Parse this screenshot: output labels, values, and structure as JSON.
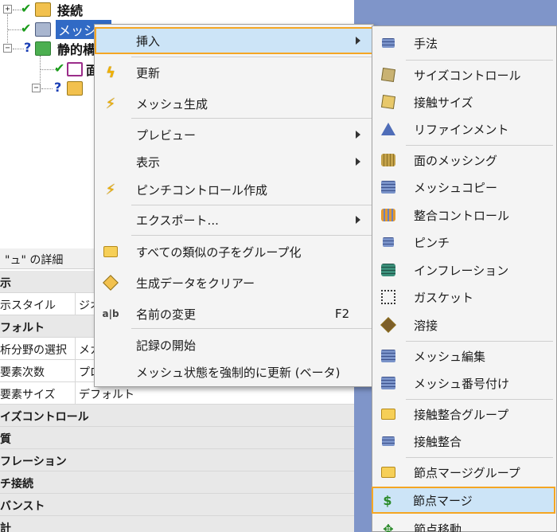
{
  "tree": {
    "row1_label": "接続",
    "row2_label": "メッシュ",
    "row3_label": "静的構",
    "row4_label": "面"
  },
  "details": {
    "header": "\"ュ\" の詳細",
    "rows": [
      {
        "c1": "示",
        "c2": "",
        "section": true
      },
      {
        "c1": "示スタイル",
        "c2": "ジオ",
        "section": false
      },
      {
        "c1": "フォルト",
        "c2": "",
        "section": true
      },
      {
        "c1": "析分野の選択",
        "c2": "メカ",
        "section": false
      },
      {
        "c1": "要素次数",
        "c2": "プロ",
        "section": false
      },
      {
        "c1": "要素サイズ",
        "c2": "デフォルト",
        "section": false
      },
      {
        "c1": "イズコントロール",
        "c2": "",
        "section": true
      },
      {
        "c1": "質",
        "c2": "",
        "section": true
      },
      {
        "c1": "フレーション",
        "c2": "",
        "section": true
      },
      {
        "c1": "チ接続",
        "c2": "",
        "section": true
      },
      {
        "c1": "バンスト",
        "c2": "",
        "section": true
      },
      {
        "c1": "計",
        "c2": "",
        "section": true
      }
    ]
  },
  "context_menu": {
    "insert": "挿入",
    "update": "更新",
    "generate_mesh": "メッシュ生成",
    "preview": "プレビュー",
    "show": "表示",
    "create_pinch": "ピンチコントロール作成",
    "export": "エクスポート...",
    "group_similar": "すべての類似の子をグループ化",
    "clear_generated": "生成データをクリアー",
    "rename": "名前の変更",
    "rename_shortcut": "F2",
    "start_recording": "記録の開始",
    "force_update": "メッシュ状態を強制的に更新 (ベータ)"
  },
  "submenu": {
    "method": "手法",
    "sizing": "サイズコントロール",
    "contact_sizing": "接触サイズ",
    "refinement": "リファインメント",
    "face_meshing": "面のメッシング",
    "mesh_copy": "メッシュコピー",
    "match_control": "整合コントロール",
    "pinch": "ピンチ",
    "inflation": "インフレーション",
    "gasket": "ガスケット",
    "weld": "溶接",
    "mesh_edit": "メッシュ編集",
    "mesh_numbering": "メッシュ番号付け",
    "contact_match_group": "接触整合グループ",
    "contact_match": "接触整合",
    "node_merge_group": "節点マージグループ",
    "node_merge": "節点マージ",
    "node_move": "節点移動"
  },
  "colors": {
    "highlight_outline": "#f5a623",
    "highlight_fill": "#cce4f7",
    "right_bg": "#7f95c9"
  }
}
